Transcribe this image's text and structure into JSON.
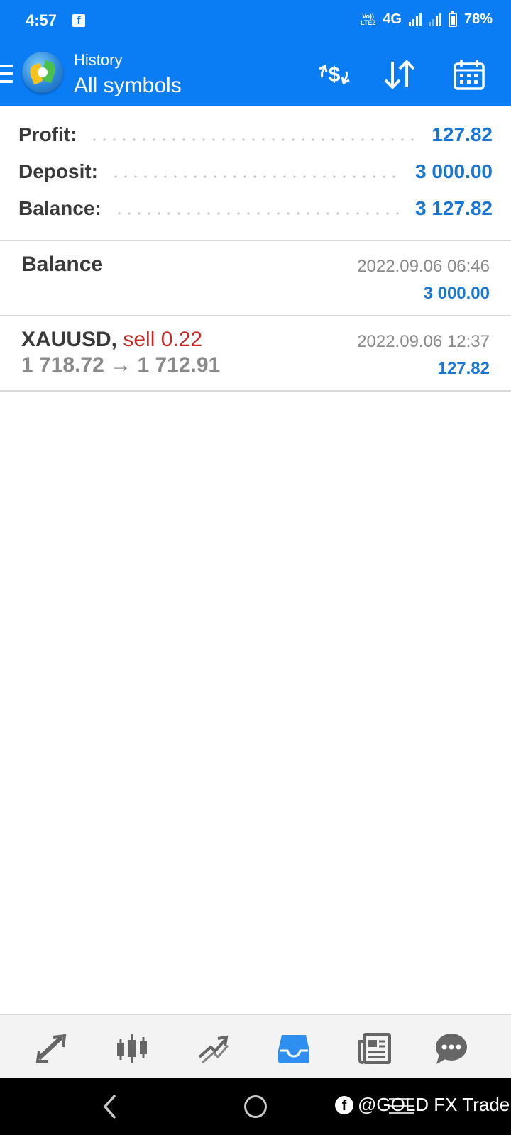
{
  "status_bar": {
    "time": "4:57",
    "volte_top": "Vo))",
    "volte_bottom": "LTE2",
    "network": "4G",
    "battery": "78%"
  },
  "app_bar": {
    "subtitle": "History",
    "title": "All symbols",
    "accent_color": "#0a7df5",
    "icons": [
      "menu-icon",
      "metatrader-logo",
      "currency-exchange-icon",
      "sort-icon",
      "calendar-icon"
    ]
  },
  "summary": {
    "profit_label": "Profit:",
    "profit_value": "127.82",
    "deposit_label": "Deposit:",
    "deposit_value": "3 000.00",
    "balance_label": "Balance:",
    "balance_value": "3 127.82"
  },
  "deals": [
    {
      "title": "Balance",
      "date": "2022.09.06 06:46",
      "amount": "3 000.00"
    },
    {
      "symbol": "XAUUSD,",
      "action": "sell 0.22",
      "prices": "1 718.72 → 1 712.91",
      "date": "2022.09.06 12:37",
      "amount": "127.82"
    }
  ],
  "bottom_nav": {
    "items": [
      "quotes-icon",
      "chart-icon",
      "trade-icon",
      "history-icon",
      "news-icon",
      "chat-icon"
    ],
    "active": "history-icon",
    "active_color": "#2f8ff0"
  },
  "watermark": {
    "text": "@GOLD FX Trade"
  }
}
